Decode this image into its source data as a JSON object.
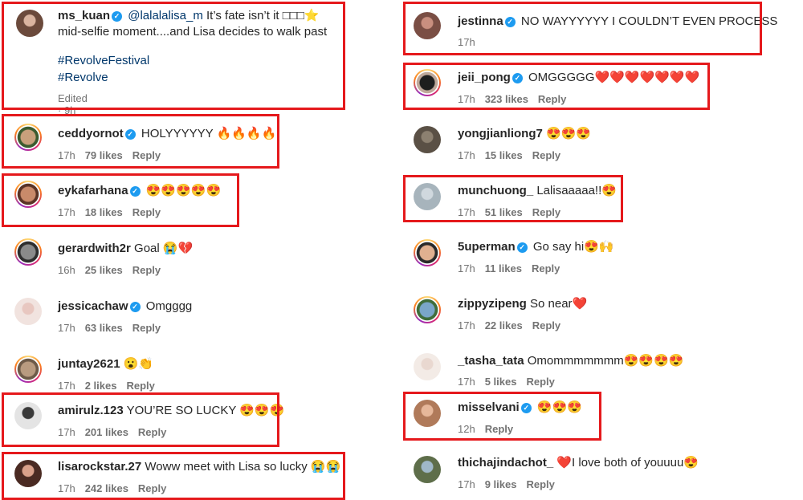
{
  "left": [
    {
      "username": "ms_kuan",
      "verified": true,
      "mention": "@lalalalisa_m",
      "text": " It’s fate isn’t it □□□⭐",
      "text2": "mid-selfie moment....and Lisa decides to walk past",
      "tags": [
        "#RevolveFestival",
        "#Revolve"
      ],
      "edited": "Edited · 9h"
    },
    {
      "username": "ceddyornot",
      "verified": true,
      "text": "HOLYYYYYY 🔥🔥🔥🔥",
      "time": "17h",
      "likes": "79 likes",
      "reply": "Reply"
    },
    {
      "username": "eykafarhana",
      "verified": true,
      "text": "😍😍😍😍😍",
      "time": "17h",
      "likes": "18 likes",
      "reply": "Reply"
    },
    {
      "username": "gerardwith2r",
      "verified": false,
      "text": "Goal 😭💔",
      "time": "16h",
      "likes": "25 likes",
      "reply": "Reply"
    },
    {
      "username": "jessicachaw",
      "verified": true,
      "text": "Omgggg",
      "time": "17h",
      "likes": "63 likes",
      "reply": "Reply"
    },
    {
      "username": "juntay2621",
      "verified": false,
      "text": "😮👏",
      "time": "17h",
      "likes": "2 likes",
      "reply": "Reply"
    },
    {
      "username": "amirulz.123",
      "verified": false,
      "text": "YOU’RE SO LUCKY 😍😍😍",
      "time": "17h",
      "likes": "201 likes",
      "reply": "Reply"
    },
    {
      "username": "lisarockstar.27",
      "verified": false,
      "text": "Woww meet with Lisa so lucky 😭😭",
      "time": "17h",
      "likes": "242 likes",
      "reply": "Reply"
    }
  ],
  "right": [
    {
      "username": "jestinna",
      "verified": true,
      "text": "NO WAYYYYYY I COULDN’T EVEN PROCESS",
      "time": "17h"
    },
    {
      "username": "jeii_pong",
      "verified": true,
      "text": "OMGGGGG❤️❤️❤️❤️❤️❤️❤️",
      "time": "17h",
      "likes": "323 likes",
      "reply": "Reply"
    },
    {
      "username": "yongjianliong7",
      "verified": false,
      "text": "😍😍😍",
      "time": "17h",
      "likes": "15 likes",
      "reply": "Reply"
    },
    {
      "username": "munchuong_",
      "verified": false,
      "text": "Lalisaaaaa!!😍",
      "time": "17h",
      "likes": "51 likes",
      "reply": "Reply"
    },
    {
      "username": "5uperman",
      "verified": true,
      "text": "Go say hi😍🙌",
      "time": "17h",
      "likes": "11 likes",
      "reply": "Reply"
    },
    {
      "username": "zippyzipeng",
      "verified": false,
      "text": "So near❤️",
      "time": "17h",
      "likes": "22 likes",
      "reply": "Reply"
    },
    {
      "username": "_tasha_tata",
      "verified": false,
      "text": "Omommmmmmm😍😍😍😍",
      "time": "17h",
      "likes": "5 likes",
      "reply": "Reply"
    },
    {
      "username": "misselvani",
      "verified": true,
      "text": "😍😍😍",
      "time": "12h",
      "reply": "Reply"
    },
    {
      "username": "thichajindachot_",
      "verified": false,
      "text": "❤️I love both of youuuu😍",
      "time": "17h",
      "likes": "9 likes",
      "reply": "Reply"
    }
  ],
  "colors": {
    "highlight": "#e5191c",
    "verified": "#1d9bf0",
    "meta": "#737373",
    "link": "#00376b"
  },
  "icons": {
    "verified": "verified-badge-icon"
  }
}
